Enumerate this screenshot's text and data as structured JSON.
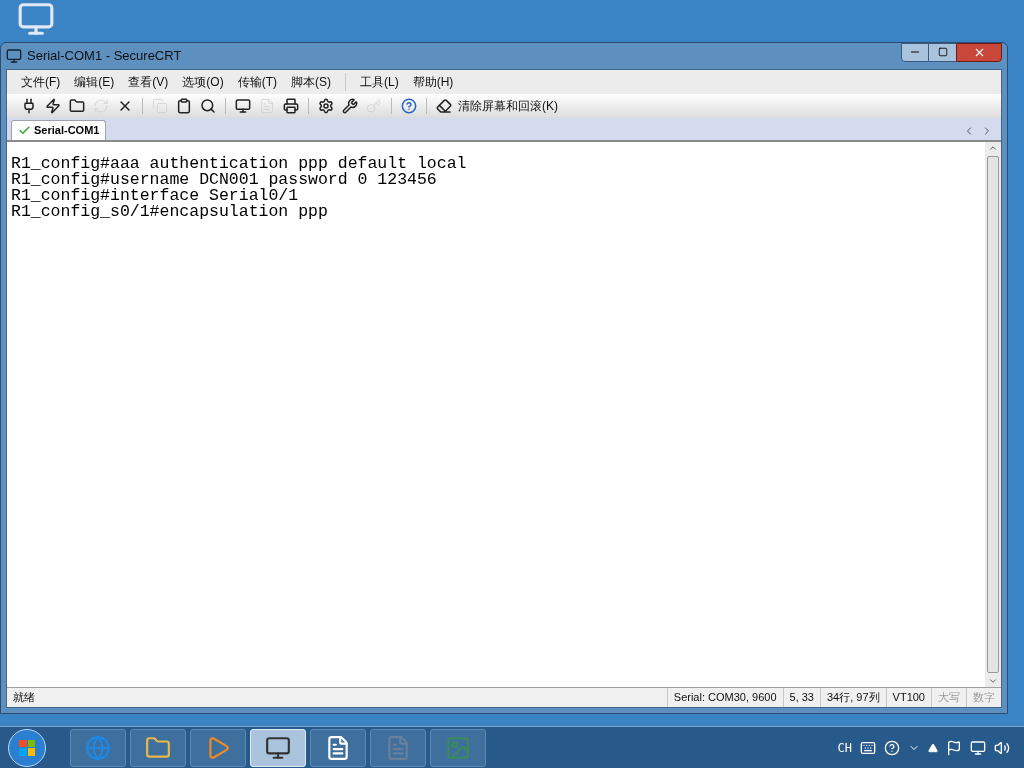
{
  "window": {
    "title": "Serial-COM1 - SecureCRT"
  },
  "menu": [
    "文件(F)",
    "编辑(E)",
    "查看(V)",
    "选项(O)",
    "传输(T)",
    "脚本(S)",
    "工具(L)",
    "帮助(H)"
  ],
  "toolbar": [
    [
      {
        "kind": "connect",
        "disabled": false
      },
      {
        "kind": "quick-connect",
        "disabled": false
      },
      {
        "kind": "folder",
        "disabled": false
      },
      {
        "kind": "reconnect",
        "disabled": true
      },
      {
        "kind": "disconnect",
        "disabled": false
      }
    ],
    [
      {
        "kind": "copy",
        "disabled": true
      },
      {
        "kind": "paste",
        "disabled": false
      },
      {
        "kind": "find",
        "disabled": false
      }
    ],
    [
      {
        "kind": "print-screen",
        "disabled": false
      },
      {
        "kind": "print-selection",
        "disabled": true
      },
      {
        "kind": "print",
        "disabled": false
      }
    ],
    [
      {
        "kind": "session-options",
        "disabled": false
      },
      {
        "kind": "global-options",
        "disabled": false
      },
      {
        "kind": "key",
        "disabled": true
      }
    ],
    [
      {
        "kind": "help",
        "disabled": false
      }
    ],
    [
      {
        "kind": "clear",
        "disabled": false,
        "label": "清除屏幕和回滚(K)"
      }
    ]
  ],
  "tabs": [
    {
      "label": "Serial-COM1",
      "selected": true
    }
  ],
  "terminal": {
    "lines": [
      "R1_config#aaa authentication ppp default local",
      "R1_config#username DCN001 password 0 123456",
      "R1_config#interface Serial0/1",
      "R1_config_s0/1#encapsulation ppp"
    ]
  },
  "status_bar": [
    {
      "text": "就绪",
      "disabled": false
    },
    {
      "text": "Serial: COM30, 9600",
      "disabled": false
    },
    {
      "text": "5, 33",
      "disabled": false
    },
    {
      "text": "34行, 97列",
      "disabled": false
    },
    {
      "text": "VT100",
      "disabled": false
    },
    {
      "text": "大写",
      "disabled": true
    },
    {
      "text": "数字",
      "disabled": true
    }
  ],
  "taskbar": {
    "items": [
      {
        "kind": "browser",
        "selected": false
      },
      {
        "kind": "folder",
        "selected": false
      },
      {
        "kind": "media",
        "selected": false
      },
      {
        "kind": "terminal",
        "selected": true
      },
      {
        "kind": "word",
        "selected": false
      },
      {
        "kind": "document",
        "selected": false
      },
      {
        "kind": "photo",
        "selected": false
      }
    ],
    "tray": {
      "language": "CH"
    }
  }
}
